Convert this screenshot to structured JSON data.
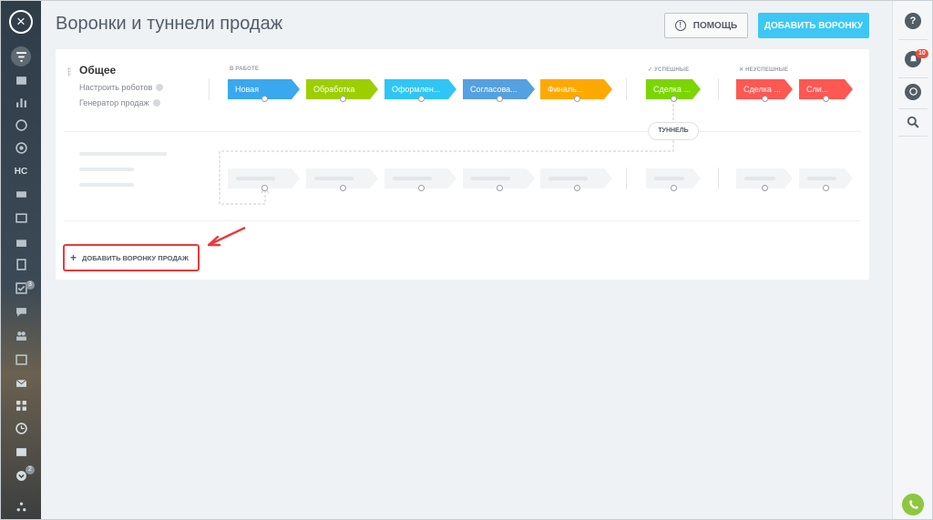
{
  "header": {
    "title": "Воронки и туннели продаж",
    "help_label": "ПОМОЩЬ",
    "add_label": "ДОБАВИТЬ ВОРОНКУ"
  },
  "sidebar": {
    "text_items": [
      "НС"
    ],
    "badges": [
      "3",
      "2"
    ]
  },
  "rightbar": {
    "notifications_count": "10"
  },
  "funnel": {
    "name": "Общее",
    "robots_link": "Настроить роботов",
    "generator_link": "Генератор продаж",
    "group_in_work": "В РАБОТЕ",
    "group_success": "УСПЕШНЫЕ",
    "group_fail": "НЕУСПЕШНЫЕ",
    "stages": [
      {
        "label": "Новая",
        "color": "#39a8ef"
      },
      {
        "label": "Обработка",
        "color": "#9dcf00"
      },
      {
        "label": "Оформлен...",
        "color": "#2fc6f6"
      },
      {
        "label": "Согласова...",
        "color": "#55a0e0"
      },
      {
        "label": "Финаль...",
        "color": "#ffa900"
      }
    ],
    "success_stage": {
      "label": "Сделка ...",
      "color": "#7bd500"
    },
    "fail_stages": [
      {
        "label": "Сделка ...",
        "color": "#ff5752"
      },
      {
        "label": "Сли...",
        "color": "#ff5752"
      }
    ],
    "tunnel_label": "ТУННЕЛЬ"
  },
  "add_funnel_label": "ДОБАВИТЬ ВОРОНКУ ПРОДАЖ",
  "colors": {
    "accent": "#3bc8f5",
    "highlight": "#e83a3a",
    "phone": "#8dc63f"
  }
}
